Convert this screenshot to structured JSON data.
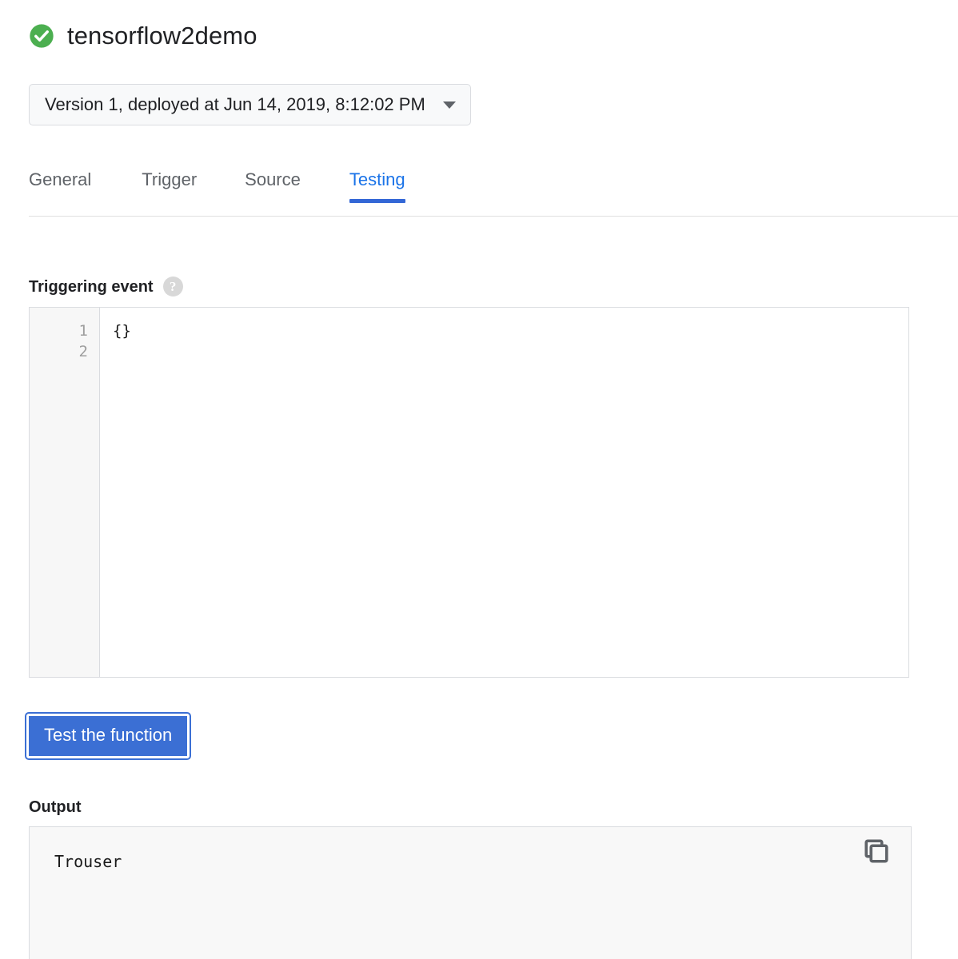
{
  "header": {
    "status_icon": "check-circle-icon",
    "status_color": "#4caf50",
    "title": "tensorflow2demo"
  },
  "version_select": {
    "label": "Version 1, deployed at Jun 14, 2019, 8:12:02 PM",
    "caret_icon": "chevron-down-icon"
  },
  "tabs": {
    "items": [
      {
        "label": "General",
        "active": false
      },
      {
        "label": "Trigger",
        "active": false
      },
      {
        "label": "Source",
        "active": false
      },
      {
        "label": "Testing",
        "active": true
      }
    ],
    "active_color": "#1a73e8",
    "underline_color": "#3367d6",
    "inactive_color": "#5f6368"
  },
  "triggering_event": {
    "label": "Triggering event",
    "help_icon": "help-circle-icon",
    "line_numbers": [
      "1",
      "2"
    ],
    "code_lines": [
      "{}"
    ]
  },
  "test_button": {
    "label": "Test the function",
    "color": "#3b6fd4"
  },
  "output": {
    "label": "Output",
    "text": "Trouser",
    "copy_icon": "copy-icon"
  }
}
